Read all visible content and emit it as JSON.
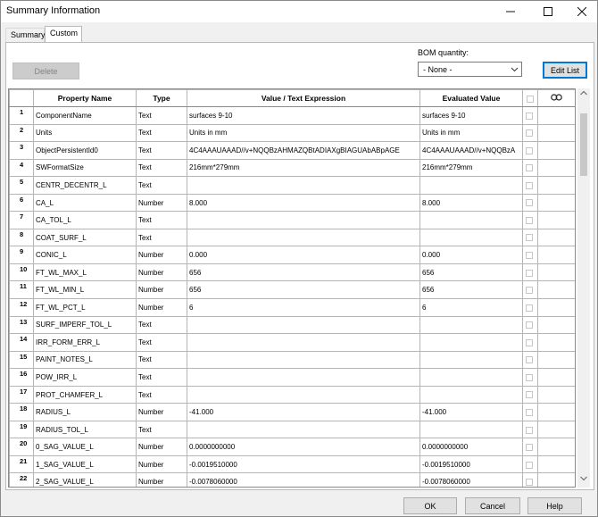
{
  "window": {
    "title": "Summary Information"
  },
  "tabs": [
    {
      "label": "Summary"
    },
    {
      "label": "Custom"
    }
  ],
  "toolbar": {
    "delete_label": "Delete",
    "bom_label": "BOM quantity:",
    "bom_value": "- None -",
    "edit_list_label": "Edit List"
  },
  "table": {
    "headers": {
      "property": "Property Name",
      "type": "Type",
      "value": "Value / Text Expression",
      "evaluated": "Evaluated Value"
    },
    "rows": [
      {
        "num": "1",
        "name": "ComponentName",
        "type": "Text",
        "value": "surfaces 9-10",
        "eval": "surfaces 9-10"
      },
      {
        "num": "2",
        "name": "Units",
        "type": "Text",
        "value": "Units in mm",
        "eval": "Units in mm"
      },
      {
        "num": "3",
        "name": "ObjectPersistentId0",
        "type": "Text",
        "value": "4C4AAAUAAAD//v+NQQBzAHMAZQBtADIAXgBIAGUAbABpAGE",
        "eval": "4C4AAAUAAAD//v+NQQBzA"
      },
      {
        "num": "4",
        "name": "SWFormatSize",
        "type": "Text",
        "value": "216mm*279mm",
        "eval": "216mm*279mm"
      },
      {
        "num": "5",
        "name": "CENTR_DECENTR_L",
        "type": "Text",
        "value": "",
        "eval": ""
      },
      {
        "num": "6",
        "name": "CA_L",
        "type": "Number",
        "value": "8.000",
        "eval": "8.000"
      },
      {
        "num": "7",
        "name": "CA_TOL_L",
        "type": "Text",
        "value": "",
        "eval": ""
      },
      {
        "num": "8",
        "name": "COAT_SURF_L",
        "type": "Text",
        "value": "",
        "eval": ""
      },
      {
        "num": "9",
        "name": "CONIC_L",
        "type": "Number",
        "value": "0.000",
        "eval": "0.000"
      },
      {
        "num": "10",
        "name": "FT_WL_MAX_L",
        "type": "Number",
        "value": "656",
        "eval": "656"
      },
      {
        "num": "11",
        "name": "FT_WL_MIN_L",
        "type": "Number",
        "value": "656",
        "eval": "656"
      },
      {
        "num": "12",
        "name": "FT_WL_PCT_L",
        "type": "Number",
        "value": "6",
        "eval": "6"
      },
      {
        "num": "13",
        "name": "SURF_IMPERF_TOL_L",
        "type": "Text",
        "value": "",
        "eval": ""
      },
      {
        "num": "14",
        "name": "IRR_FORM_ERR_L",
        "type": "Text",
        "value": "",
        "eval": ""
      },
      {
        "num": "15",
        "name": "PAINT_NOTES_L",
        "type": "Text",
        "value": "",
        "eval": ""
      },
      {
        "num": "16",
        "name": "POW_IRR_L",
        "type": "Text",
        "value": "",
        "eval": ""
      },
      {
        "num": "17",
        "name": "PROT_CHAMFER_L",
        "type": "Text",
        "value": "",
        "eval": ""
      },
      {
        "num": "18",
        "name": "RADIUS_L",
        "type": "Number",
        "value": "-41.000",
        "eval": "-41.000"
      },
      {
        "num": "19",
        "name": "RADIUS_TOL_L",
        "type": "Text",
        "value": "",
        "eval": ""
      },
      {
        "num": "20",
        "name": "0_SAG_VALUE_L",
        "type": "Number",
        "value": "0.0000000000",
        "eval": "0.0000000000"
      },
      {
        "num": "21",
        "name": "1_SAG_VALUE_L",
        "type": "Number",
        "value": "-0.0019510000",
        "eval": "-0.0019510000"
      },
      {
        "num": "22",
        "name": "2_SAG_VALUE_L",
        "type": "Number",
        "value": "-0.0078060000",
        "eval": "-0.0078060000"
      }
    ]
  },
  "footer": {
    "ok_label": "OK",
    "cancel_label": "Cancel",
    "help_label": "Help"
  },
  "icons": {
    "link": "link-icon",
    "minimize": "minimize-icon",
    "maximize": "maximize-icon",
    "close": "close-icon"
  }
}
